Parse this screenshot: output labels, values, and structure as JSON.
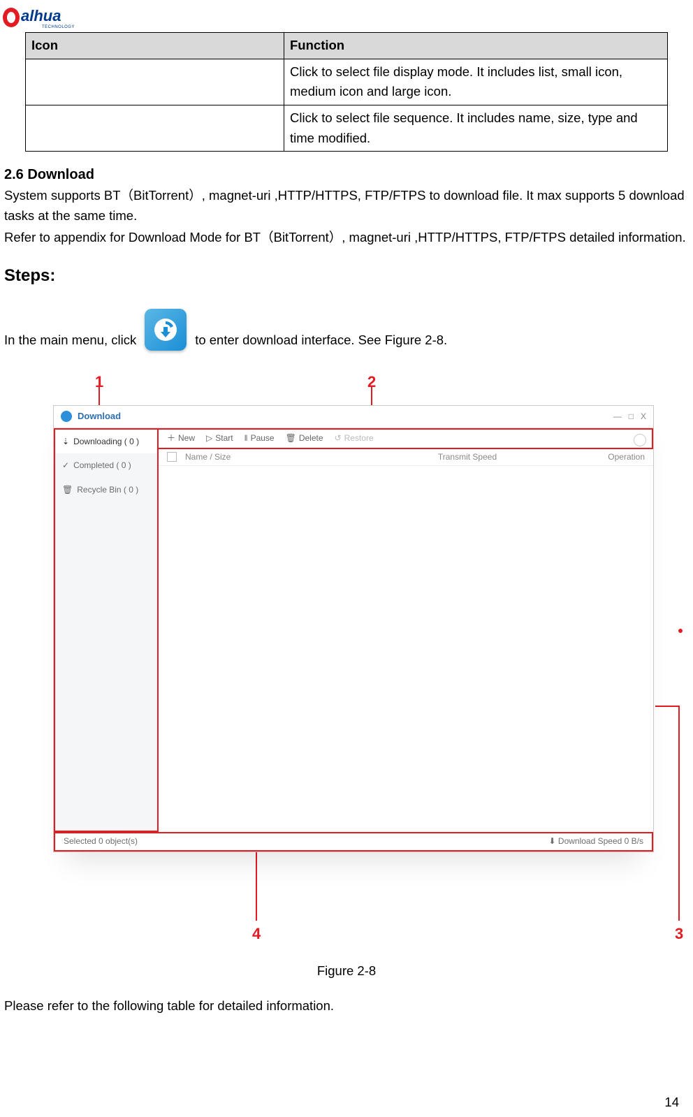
{
  "logo": {
    "brand": "alhua",
    "sub": "TECHNOLOGY"
  },
  "table": {
    "headers": {
      "icon": "Icon",
      "function": "Function"
    },
    "rows": [
      {
        "icon": "",
        "function": "Click to select file display mode. It includes list, small icon, medium icon and large icon."
      },
      {
        "icon": "",
        "function": "Click to select file sequence. It includes name, size, type and time modified."
      }
    ]
  },
  "section": {
    "heading": "2.6 Download",
    "p1": "System supports BT（BitTorrent）, magnet-uri ,HTTP/HTTPS, FTP/FTPS to download file. It max supports 5 download tasks at the same time.",
    "p2": "Refer to appendix for Download Mode for BT（BitTorrent）, magnet-uri ,HTTP/HTTPS, FTP/FTPS detailed information.",
    "steps_heading": "Steps:",
    "click_before": "In the main menu, click",
    "click_after": "to enter download interface. See Figure 2-8.",
    "figcaption": "Figure 2-8",
    "after_fig": "Please refer to the following table for detailed information."
  },
  "callouts": {
    "n1": "1",
    "n2": "2",
    "n3": "3",
    "n4": "4"
  },
  "shot": {
    "title": "Download",
    "win": {
      "min": "—",
      "max": "□",
      "close": "X"
    },
    "sidebar": {
      "downloading": "Downloading ( 0 )",
      "completed": "Completed ( 0 )",
      "recycle": "Recycle Bin ( 0 )"
    },
    "toolbar": {
      "new": "New",
      "start": "Start",
      "pause": "Pause",
      "delete": "Delete",
      "restore": "Restore"
    },
    "columns": {
      "name": "Name / Size",
      "speed": "Transmit Speed",
      "op": "Operation"
    },
    "status": {
      "selected": "Selected 0 object(s)",
      "speed": "Download Speed 0 B/s"
    }
  },
  "page_number": "14"
}
